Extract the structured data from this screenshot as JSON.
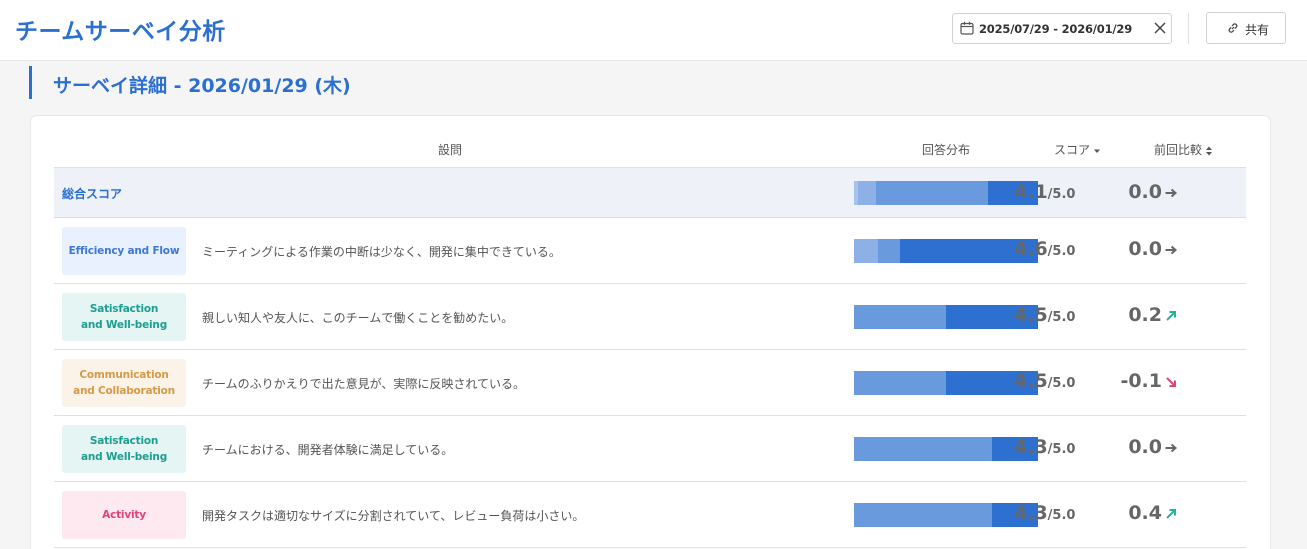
{
  "header": {
    "title": "チームサーベイ分析",
    "date_range": "2025/07/29 - 2026/01/29",
    "share_label": "共有"
  },
  "section": {
    "title": "サーベイ詳細 - 2026/01/29 (木)"
  },
  "table": {
    "columns": {
      "question": "設問",
      "distribution": "回答分布",
      "score": "スコア",
      "compare": "前回比較"
    },
    "score_max": "/5.0",
    "total": {
      "label": "総合スコア",
      "score": "4.1",
      "change": "0.0",
      "trend": "flat",
      "distribution": [
        0.02,
        0.1,
        0.61,
        0.27
      ]
    },
    "rows": [
      {
        "category": "Efficiency and Flow",
        "category_key": "efficiency",
        "question": "ミーティングによる作業の中断は少なく、開発に集中できている。",
        "score": "4.6",
        "change": "0.0",
        "trend": "flat",
        "distribution": [
          0.13,
          0.12,
          0.75
        ]
      },
      {
        "category": "Satisfaction\nand Well-being",
        "category_key": "satisfaction",
        "question": "親しい知人や友人に、このチームで働くことを勧めたい。",
        "score": "4.5",
        "change": "0.2",
        "trend": "up",
        "distribution": [
          0.5,
          0.5
        ]
      },
      {
        "category": "Communication\nand Collaboration",
        "category_key": "communication",
        "question": "チームのふりかえりで出た意見が、実際に反映されている。",
        "score": "4.5",
        "change": "-0.1",
        "trend": "down",
        "distribution": [
          0.5,
          0.5
        ]
      },
      {
        "category": "Satisfaction\nand Well-being",
        "category_key": "satisfaction",
        "question": "チームにおける、開発者体験に満足している。",
        "score": "4.3",
        "change": "0.0",
        "trend": "flat",
        "distribution": [
          0.75,
          0.25
        ]
      },
      {
        "category": "Activity",
        "category_key": "activity",
        "question": "開発タスクは適切なサイズに分割されていて、レビュー負荷は小さい。",
        "score": "4.3",
        "change": "0.4",
        "trend": "up",
        "distribution": [
          0.75,
          0.25
        ]
      }
    ]
  },
  "colors": {
    "accent": "#2b6fd0",
    "trend_up": "#22b3a6",
    "trend_down": "#e0427a",
    "trend_flat": "#666666"
  }
}
